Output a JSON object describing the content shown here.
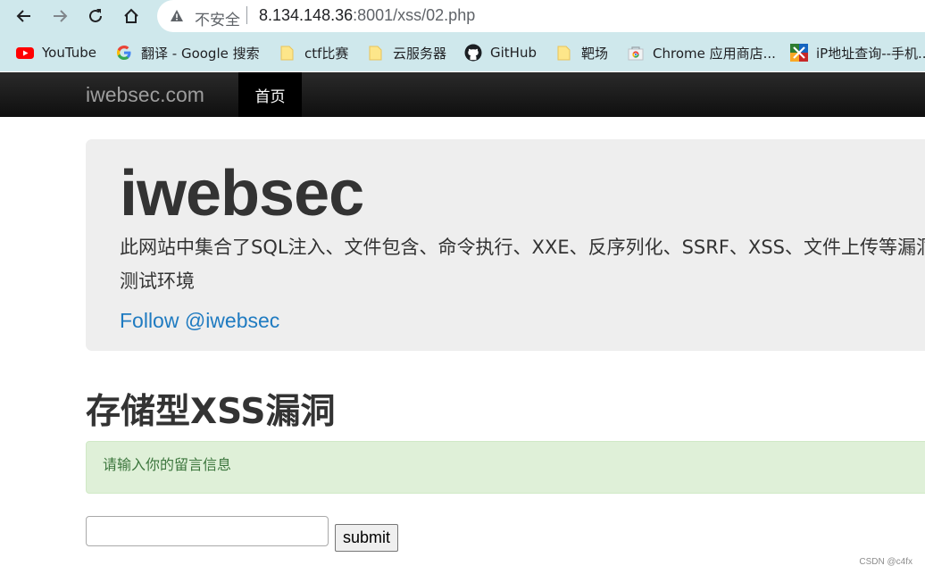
{
  "browser": {
    "insecure_label": "不安全",
    "url_host": "8.134.148.36",
    "url_path": ":8001/xss/02.php",
    "bookmarks": [
      {
        "label": "YouTube",
        "icon": "youtube-icon"
      },
      {
        "label": "翻译 - Google 搜索",
        "icon": "google-icon"
      },
      {
        "label": "ctf比赛",
        "icon": "folder-icon"
      },
      {
        "label": "云服务器",
        "icon": "folder-icon"
      },
      {
        "label": "GitHub",
        "icon": "github-icon"
      },
      {
        "label": "靶场",
        "icon": "folder-icon"
      },
      {
        "label": "Chrome 应用商店...",
        "icon": "chrome-webstore-icon"
      },
      {
        "label": "iP地址查询--手机...",
        "icon": "ip-lookup-icon"
      }
    ]
  },
  "navbar": {
    "brand": "iwebsec.com",
    "home": "首页"
  },
  "jumbotron": {
    "title": "iwebsec",
    "lead": "此网站中集合了SQL注入、文件包含、命令执行、XXE、反序列化、SSRF、XSS、文件上传等漏洞的测试环境",
    "follow": "Follow @iwebsec"
  },
  "content": {
    "heading": "存储型XSS漏洞",
    "alert": "请输入你的留言信息",
    "input_value": "",
    "submit_label": "submit"
  },
  "watermark": "CSDN @c4fx",
  "colors": {
    "chrome_bg": "#cfe8ec",
    "navbar_bg": "#222222",
    "link": "#1f7bc1",
    "alert_bg": "#dff0d8",
    "alert_text": "#3c763d"
  }
}
